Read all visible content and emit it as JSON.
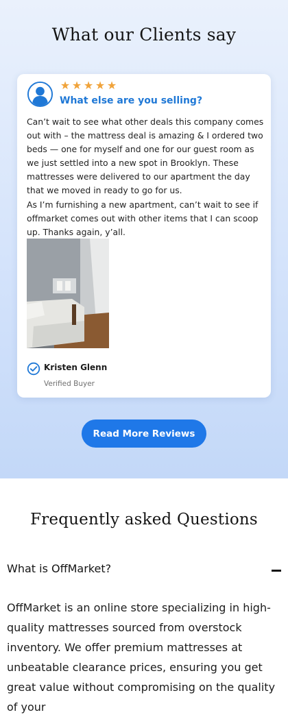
{
  "testimonials": {
    "title": "What our Clients say",
    "rating_stars": 5,
    "star_color": "#f0a33a",
    "review": {
      "title": "What else are you selling?",
      "paragraphs": [
        "Can’t wait to see what other deals this company comes out with – the mattress deal is amazing & I ordered two beds — one for myself and one for our guest room as we just settled into a new spot in Brooklyn. These mattresses were delivered to our apartment the day that we moved in ready to go for us.",
        "As I’m furnishing a new apartment, can’t wait to see if offmarket comes out with other items that I can scoop up. Thanks again, y’all."
      ],
      "reviewer_name": "Kristen Glenn",
      "reviewer_role": "Verified Buyer"
    },
    "read_more_label": "Read More Reviews",
    "accent_color": "#1f78e8"
  },
  "faq": {
    "title": "Frequently asked Questions",
    "items": [
      {
        "question": "What is OffMarket?",
        "answer": "OffMarket is an online store specializing in high-quality mattresses sourced from overstock inventory. We offer premium mattresses at unbeatable clearance prices, ensuring you get great value without compromising on the quality of your"
      }
    ]
  }
}
